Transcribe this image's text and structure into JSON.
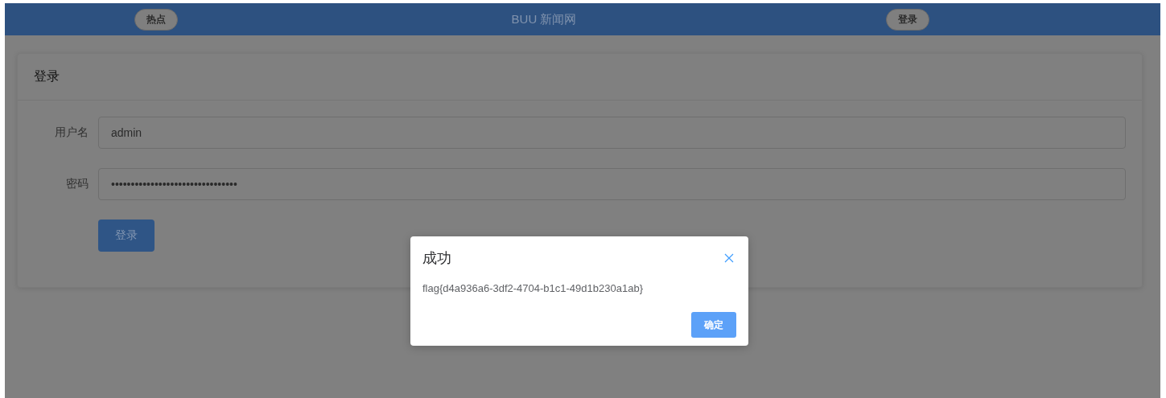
{
  "navbar": {
    "left_button": "热点",
    "title": "BUU 新闻网",
    "right_button": "登录"
  },
  "login_card": {
    "title": "登录",
    "fields": [
      {
        "label": "用户名",
        "value": "admin"
      },
      {
        "label": "密码",
        "value": "••••••••••••••••••••••••••••••••"
      }
    ],
    "submit": "登录"
  },
  "dialog": {
    "title": "成功",
    "message": "flag{d4a936a6-3df2-4704-b1c1-49d1b230a1ab}",
    "confirm": "确定"
  }
}
